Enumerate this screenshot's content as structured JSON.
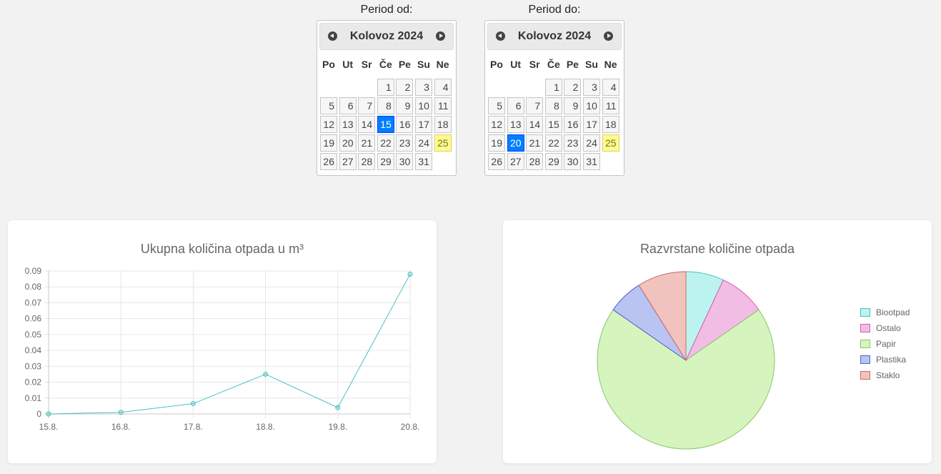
{
  "period_from": {
    "label": "Period od:",
    "month_title": "Kolovoz 2024",
    "weekdays": [
      "Po",
      "Ut",
      "Sr",
      "Če",
      "Pe",
      "Su",
      "Ne"
    ],
    "first_weekday_offset": 3,
    "days_in_month": 31,
    "selected_day": 15,
    "today_day": 25
  },
  "period_to": {
    "label": "Period do:",
    "month_title": "Kolovoz 2024",
    "weekdays": [
      "Po",
      "Ut",
      "Sr",
      "Če",
      "Pe",
      "Su",
      "Ne"
    ],
    "first_weekday_offset": 3,
    "days_in_month": 31,
    "selected_day": 20,
    "today_day": 25
  },
  "line_chart": {
    "title": "Ukupna količina otpada u m³",
    "chart_data": {
      "type": "line",
      "categories": [
        "15.8.",
        "16.8.",
        "17.8.",
        "18.8.",
        "19.8.",
        "20.8."
      ],
      "series": [
        {
          "values": [
            0,
            0.001,
            0.0065,
            0.025,
            0.004,
            0.088
          ]
        }
      ],
      "yticks": [
        "0",
        "0.01",
        "0.02",
        "0.03",
        "0.04",
        "0.05",
        "0.06",
        "0.07",
        "0.08",
        "0.09"
      ],
      "ylim": [
        0,
        0.09
      ],
      "grid": true,
      "color": "#4bc0c0"
    }
  },
  "pie_chart": {
    "title": "Razvrstane količine otpada",
    "chart_data": {
      "type": "pie",
      "categories": [
        "Biootpad",
        "Ostalo",
        "Papir",
        "Plastika",
        "Staklo"
      ],
      "values": [
        7,
        8.5,
        70,
        6.5,
        9
      ],
      "fill_colors": [
        "#bdf3ef",
        "#f2bde4",
        "#d6f4be",
        "#bac4f2",
        "#f1c3bf"
      ],
      "border_colors": [
        "#4bc0c0",
        "#d65db1",
        "#8cc66b",
        "#5060c8",
        "#c96a63"
      ],
      "legend_position": "right"
    }
  }
}
